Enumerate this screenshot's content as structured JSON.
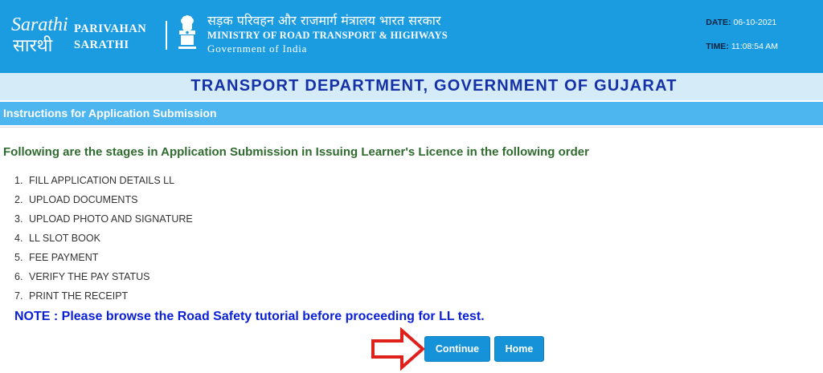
{
  "header": {
    "logo_text": "Sarathi",
    "logo_text_hindi": "सारथी",
    "brand_line1": "PARIVAHAN",
    "brand_line2": "SARATHI",
    "ministry_hindi": "सड़क परिवहन और राजमार्ग मंत्रालय भारत सरकार",
    "ministry_english": "MINISTRY OF ROAD TRANSPORT & HIGHWAYS",
    "government": "Government of India",
    "date_label": "DATE:",
    "date_value": "06-10-2021",
    "time_label": "TIME:",
    "time_value": "11:08:54 AM"
  },
  "department": {
    "title": "TRANSPORT DEPARTMENT, GOVERNMENT OF GUJARAT"
  },
  "instructions": {
    "bar_title": "Instructions for Application Submission",
    "heading": "Following are the stages in Application Submission in Issuing Learner's Licence in the following order",
    "steps": [
      {
        "num": "1.",
        "label": "FILL APPLICATION DETAILS LL"
      },
      {
        "num": "2.",
        "label": "UPLOAD DOCUMENTS"
      },
      {
        "num": "3.",
        "label": "UPLOAD PHOTO AND SIGNATURE"
      },
      {
        "num": "4.",
        "label": "LL SLOT BOOK"
      },
      {
        "num": "5.",
        "label": "FEE PAYMENT"
      },
      {
        "num": "6.",
        "label": "VERIFY THE PAY STATUS"
      },
      {
        "num": "7.",
        "label": "PRINT THE RECEIPT"
      }
    ],
    "note": "NOTE : Please browse the Road Safety tutorial before proceeding for LL test."
  },
  "actions": {
    "continue_label": "Continue",
    "home_label": "Home"
  },
  "colors": {
    "header_bg": "#1b9be0",
    "subheader_bg": "#d5ebf7",
    "instr_bar_bg": "#4eb6ef",
    "dept_title": "#1431a8",
    "heading_green": "#2f6b2f",
    "note_blue": "#0a1fd6",
    "button_bg": "#1592d8",
    "arrow_red": "#e0201a"
  }
}
